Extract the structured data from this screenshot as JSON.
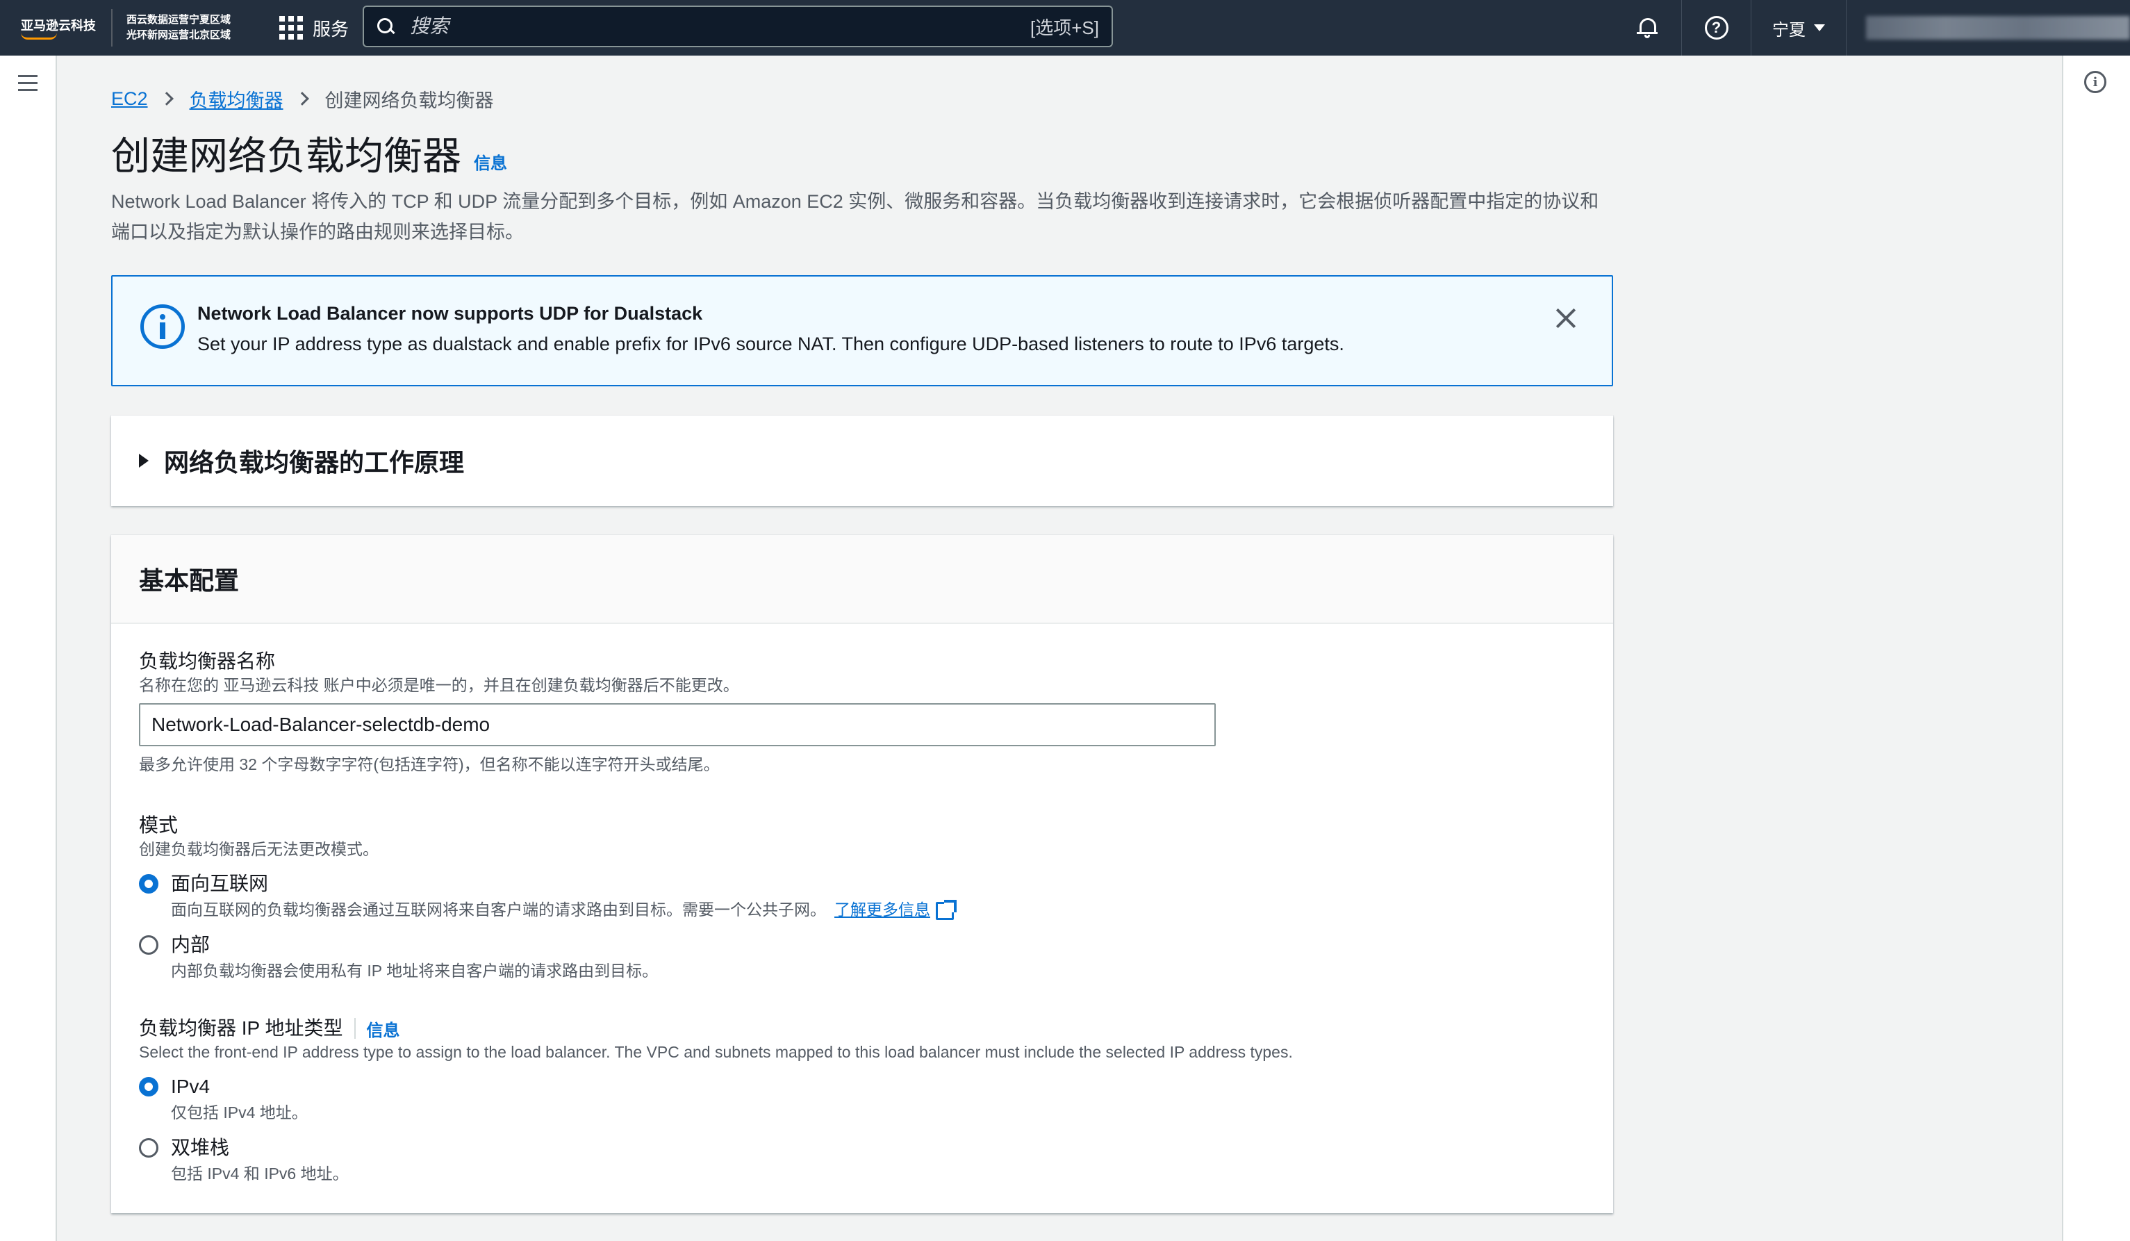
{
  "topnav": {
    "brand": "亚马逊云科技",
    "region_line1": "西云数据运营宁夏区域",
    "region_line2": "光环新网运营北京区域",
    "services_label": "服务",
    "search_placeholder": "搜索",
    "search_shortcut": "[选项+S]",
    "region_selector": "宁夏"
  },
  "breadcrumb": {
    "items": [
      "EC2",
      "负载均衡器"
    ],
    "current": "创建网络负载均衡器"
  },
  "page": {
    "title": "创建网络负载均衡器",
    "info_link": "信息",
    "description": "Network Load Balancer 将传入的 TCP 和 UDP 流量分配到多个目标，例如 Amazon EC2 实例、微服务和容器。当负载均衡器收到连接请求时，它会根据侦听器配置中指定的协议和端口以及指定为默认操作的路由规则来选择目标。"
  },
  "alert": {
    "title": "Network Load Balancer now supports UDP for Dualstack",
    "text": "Set your IP address type as dualstack and enable prefix for IPv6 source NAT. Then configure UDP-based listeners to route to IPv6 targets."
  },
  "expander": {
    "title": "网络负载均衡器的工作原理"
  },
  "basic_config": {
    "title": "基本配置",
    "name_field": {
      "label": "负载均衡器名称",
      "description": "名称在您的 亚马逊云科技 账户中必须是唯一的，并且在创建负载均衡器后不能更改。",
      "value": "Network-Load-Balancer-selectdb-demo",
      "constraint": "最多允许使用 32 个字母数字字符(包括连字符)，但名称不能以连字符开头或结尾。"
    },
    "scheme": {
      "label": "模式",
      "description": "创建负载均衡器后无法更改模式。",
      "options": [
        {
          "label": "面向互联网",
          "description": "面向互联网的负载均衡器会通过互联网将来自客户端的请求路由到目标。需要一个公共子网。",
          "link": "了解更多信息",
          "checked": true
        },
        {
          "label": "内部",
          "description": "内部负载均衡器会使用私有 IP 地址将来自客户端的请求路由到目标。",
          "checked": false
        }
      ]
    },
    "ip_type": {
      "label": "负载均衡器 IP 地址类型",
      "info_link": "信息",
      "description": "Select the front-end IP address type to assign to the load balancer. The VPC and subnets mapped to this load balancer must include the selected IP address types.",
      "options": [
        {
          "label": "IPv4",
          "description": "仅包括 IPv4 地址。",
          "checked": true
        },
        {
          "label": "双堆栈",
          "description": "包括 IPv4 和 IPv6 地址。",
          "checked": false
        }
      ]
    }
  },
  "colors": {
    "nav_bg": "#232f3e",
    "accent": "#0972d3",
    "alert_bg": "#f1faff",
    "brand_orange": "#ff9900"
  }
}
